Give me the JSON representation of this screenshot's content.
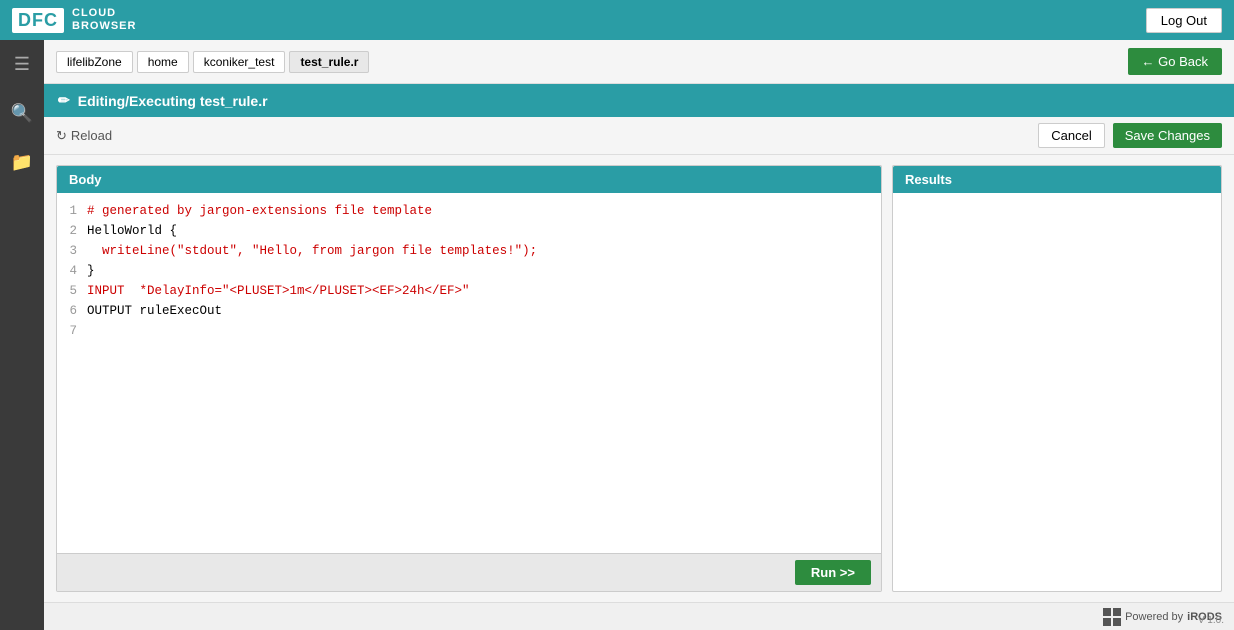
{
  "header": {
    "logo_text": "DFC",
    "logo_subtitle_line1": "CLOUD",
    "logo_subtitle_line2": "BROWSER",
    "logout_label": "Log Out"
  },
  "breadcrumb": {
    "items": [
      {
        "label": "lifelibZone",
        "active": false
      },
      {
        "label": "home",
        "active": false
      },
      {
        "label": "kconiker_test",
        "active": false
      },
      {
        "label": "test_rule.r",
        "active": true
      }
    ],
    "go_back_label": "← Go Back"
  },
  "title_bar": {
    "icon": "✏",
    "text": "Editing/Executing test_rule.r"
  },
  "toolbar": {
    "reload_label": "Reload",
    "cancel_label": "Cancel",
    "save_label": "Save Changes"
  },
  "body_panel": {
    "header": "Body"
  },
  "results_panel": {
    "header": "Results"
  },
  "code": {
    "lines": [
      {
        "num": "1",
        "content": "# generated by jargon-extensions file template",
        "type": "comment"
      },
      {
        "num": "2",
        "content": "HelloWorld {",
        "type": "default"
      },
      {
        "num": "3",
        "content": "  writeLine(\"stdout\", \"Hello, from jargon file templates!\");",
        "type": "string"
      },
      {
        "num": "4",
        "content": "}",
        "type": "default"
      },
      {
        "num": "5",
        "content": "INPUT  *DelayInfo=\"<PLUSET>1m</PLUSET><EF>24h</EF>\"",
        "type": "input"
      },
      {
        "num": "6",
        "content": "OUTPUT ruleExecOut",
        "type": "default"
      },
      {
        "num": "7",
        "content": "",
        "type": "default"
      }
    ]
  },
  "run_btn": {
    "label": "Run >>"
  },
  "footer": {
    "powered_by": "Powered by",
    "irods": "iRODS",
    "version": "V 1.0."
  },
  "sidebar": {
    "icons": [
      "☰",
      "🔍",
      "📁"
    ]
  }
}
